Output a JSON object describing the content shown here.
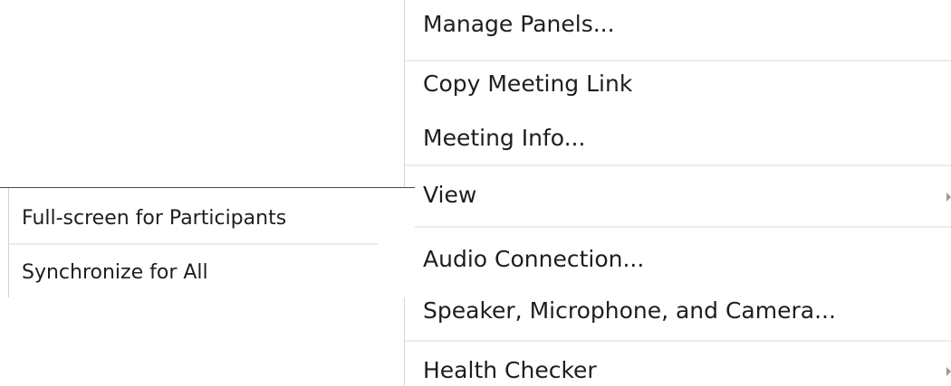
{
  "menu": {
    "items": [
      {
        "label": "Manage Panels..."
      },
      {
        "label": "Copy Meeting Link"
      },
      {
        "label": "Meeting Info..."
      },
      {
        "label": "View"
      },
      {
        "label": "Audio Connection..."
      },
      {
        "label": "Speaker, Microphone, and Camera..."
      },
      {
        "label": "Health Checker"
      }
    ]
  },
  "submenu": {
    "items": [
      {
        "label": "Full-screen for Participants"
      },
      {
        "label": "Synchronize for All"
      }
    ]
  },
  "icons": {
    "submenu_arrow": "chevron-right-icon"
  }
}
